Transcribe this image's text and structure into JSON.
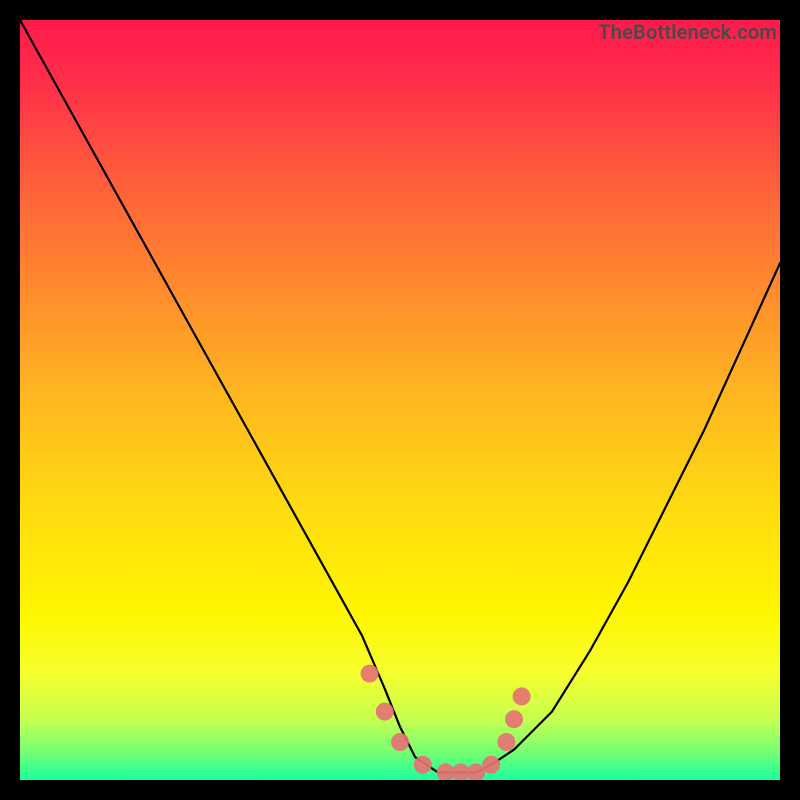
{
  "watermark": "TheBottleneck.com",
  "chart_data": {
    "type": "line",
    "title": "",
    "xlabel": "",
    "ylabel": "",
    "xlim": [
      0,
      100
    ],
    "ylim": [
      0,
      100
    ],
    "grid": false,
    "series": [
      {
        "name": "bottleneck-curve",
        "color": "#000000",
        "x": [
          0,
          5,
          10,
          15,
          20,
          25,
          30,
          35,
          40,
          45,
          48,
          50,
          52,
          55,
          58,
          60,
          62,
          65,
          70,
          75,
          80,
          85,
          90,
          95,
          100
        ],
        "y": [
          100,
          91,
          82,
          73,
          64,
          55,
          46,
          37,
          28,
          19,
          12,
          7,
          3,
          1,
          1,
          1,
          2,
          4,
          9,
          17,
          26,
          36,
          46,
          57,
          68
        ]
      }
    ],
    "markers": {
      "name": "highlight-points",
      "color": "#e57373",
      "radius": 9,
      "points": [
        {
          "x": 46,
          "y": 14
        },
        {
          "x": 48,
          "y": 9
        },
        {
          "x": 50,
          "y": 5
        },
        {
          "x": 53,
          "y": 2
        },
        {
          "x": 56,
          "y": 1
        },
        {
          "x": 58,
          "y": 1
        },
        {
          "x": 60,
          "y": 1
        },
        {
          "x": 62,
          "y": 2
        },
        {
          "x": 64,
          "y": 5
        },
        {
          "x": 65,
          "y": 8
        },
        {
          "x": 66,
          "y": 11
        }
      ]
    },
    "background_gradient": {
      "type": "vertical",
      "stops": [
        {
          "pos": 0.0,
          "color": "#ff1a4d"
        },
        {
          "pos": 0.08,
          "color": "#ff2e4a"
        },
        {
          "pos": 0.2,
          "color": "#ff5a3c"
        },
        {
          "pos": 0.35,
          "color": "#ff8a2e"
        },
        {
          "pos": 0.5,
          "color": "#ffb820"
        },
        {
          "pos": 0.65,
          "color": "#ffdd10"
        },
        {
          "pos": 0.78,
          "color": "#fff600"
        },
        {
          "pos": 0.86,
          "color": "#f6ff2e"
        },
        {
          "pos": 0.92,
          "color": "#c6ff50"
        },
        {
          "pos": 0.96,
          "color": "#7dff70"
        },
        {
          "pos": 1.0,
          "color": "#1aff9e"
        }
      ]
    }
  }
}
